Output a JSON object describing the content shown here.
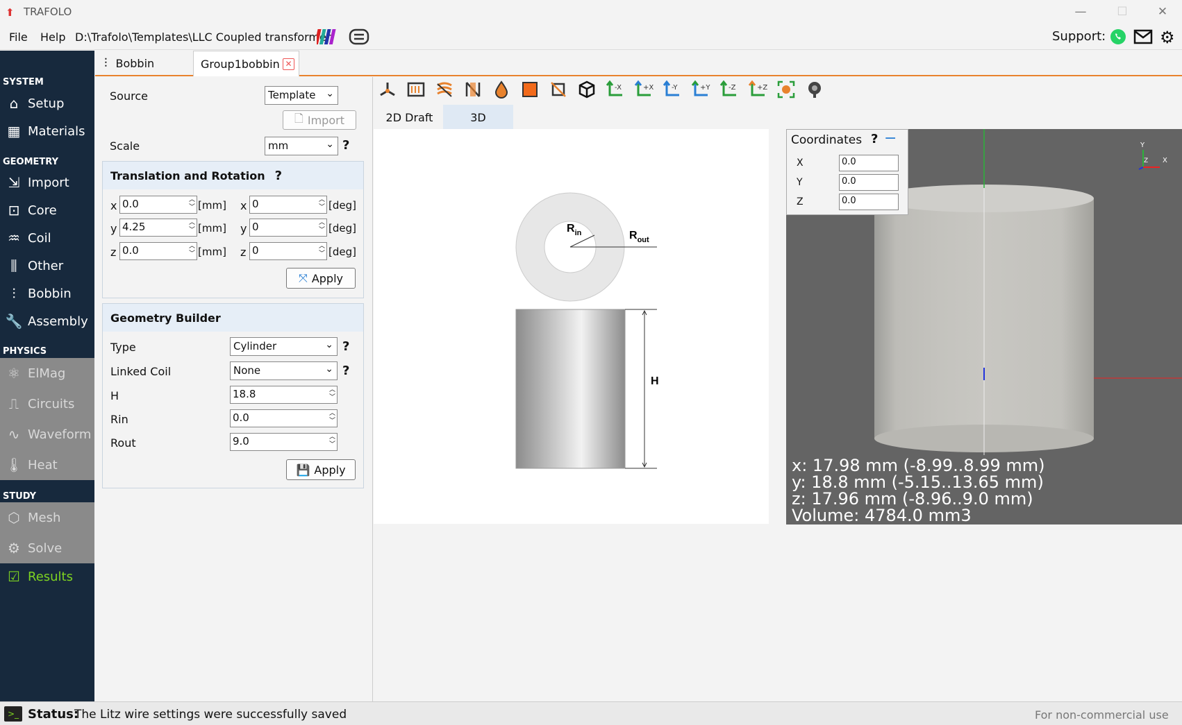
{
  "window": {
    "title": "TRAFOLO",
    "minimize": "—",
    "maximize": "☐",
    "close": "✕"
  },
  "menu": {
    "file": "File",
    "help": "Help",
    "path": "D:\\Trafolo\\Templates\\LLC Coupled transformer",
    "support_label": "Support:"
  },
  "sidebar": {
    "system": "SYSTEM",
    "setup": "Setup",
    "materials": "Materials",
    "geometry": "GEOMETRY",
    "import": "Import",
    "core": "Core",
    "coil": "Coil",
    "other": "Other",
    "bobbin": "Bobbin",
    "assembly": "Assembly",
    "physics": "PHYSICS",
    "elmag": "ElMag",
    "circuits": "Circuits",
    "waveform": "Waveform",
    "heat": "Heat",
    "study": "STUDY",
    "mesh": "Mesh",
    "solve": "Solve",
    "results": "Results"
  },
  "tabs": {
    "bobbin": "Bobbin",
    "group": "Group1bobbin"
  },
  "source": {
    "label": "Source",
    "value": "Template",
    "import_btn": "Import"
  },
  "scale": {
    "label": "Scale",
    "value": "mm"
  },
  "translation": {
    "title": "Translation and Rotation",
    "help": "?",
    "tx_label": "x",
    "tx": "0.0",
    "ty_label": "y",
    "ty": "4.25",
    "tz_label": "z",
    "tz": "0.0",
    "rx_label": "x",
    "rx": "0",
    "ry_label": "y",
    "ry": "0",
    "rz_label": "z",
    "rz": "0",
    "unit_mm": "[mm]",
    "unit_deg": "[deg]",
    "apply": "Apply"
  },
  "builder": {
    "title": "Geometry Builder",
    "type_label": "Type",
    "type_value": "Cylinder",
    "linked_label": "Linked Coil",
    "linked_value": "None",
    "h_label": "H",
    "h_value": "18.8",
    "rin_label": "Rin",
    "rin_value": "0.0",
    "rout_label": "Rout",
    "rout_value": "9.0",
    "apply": "Apply"
  },
  "view_tabs": {
    "draft": "2D Draft",
    "three_d": "3D"
  },
  "draft": {
    "rin_main": "R",
    "rin_sub": "in",
    "rout_main": "R",
    "rout_sub": "out",
    "h": "H"
  },
  "coordinates": {
    "title": "Coordinates",
    "help": "?",
    "x_label": "X",
    "x": "0.0",
    "y_label": "Y",
    "y": "0.0",
    "z_label": "Z",
    "z": "0.0"
  },
  "viewport": {
    "axis_y": "Y",
    "axis_x": "X",
    "axis_z": "Z",
    "info_x": "x: 17.98 mm (-8.99..8.99 mm)",
    "info_y": "y: 18.8 mm (-5.15..13.65 mm)",
    "info_z": "z: 17.96 mm (-8.96..9.0 mm)",
    "info_volume": "Volume: 4784.0 mm3"
  },
  "status": {
    "label": "Status:",
    "message": "The Litz wire settings were successfully saved",
    "license": "For non-commercial use"
  }
}
